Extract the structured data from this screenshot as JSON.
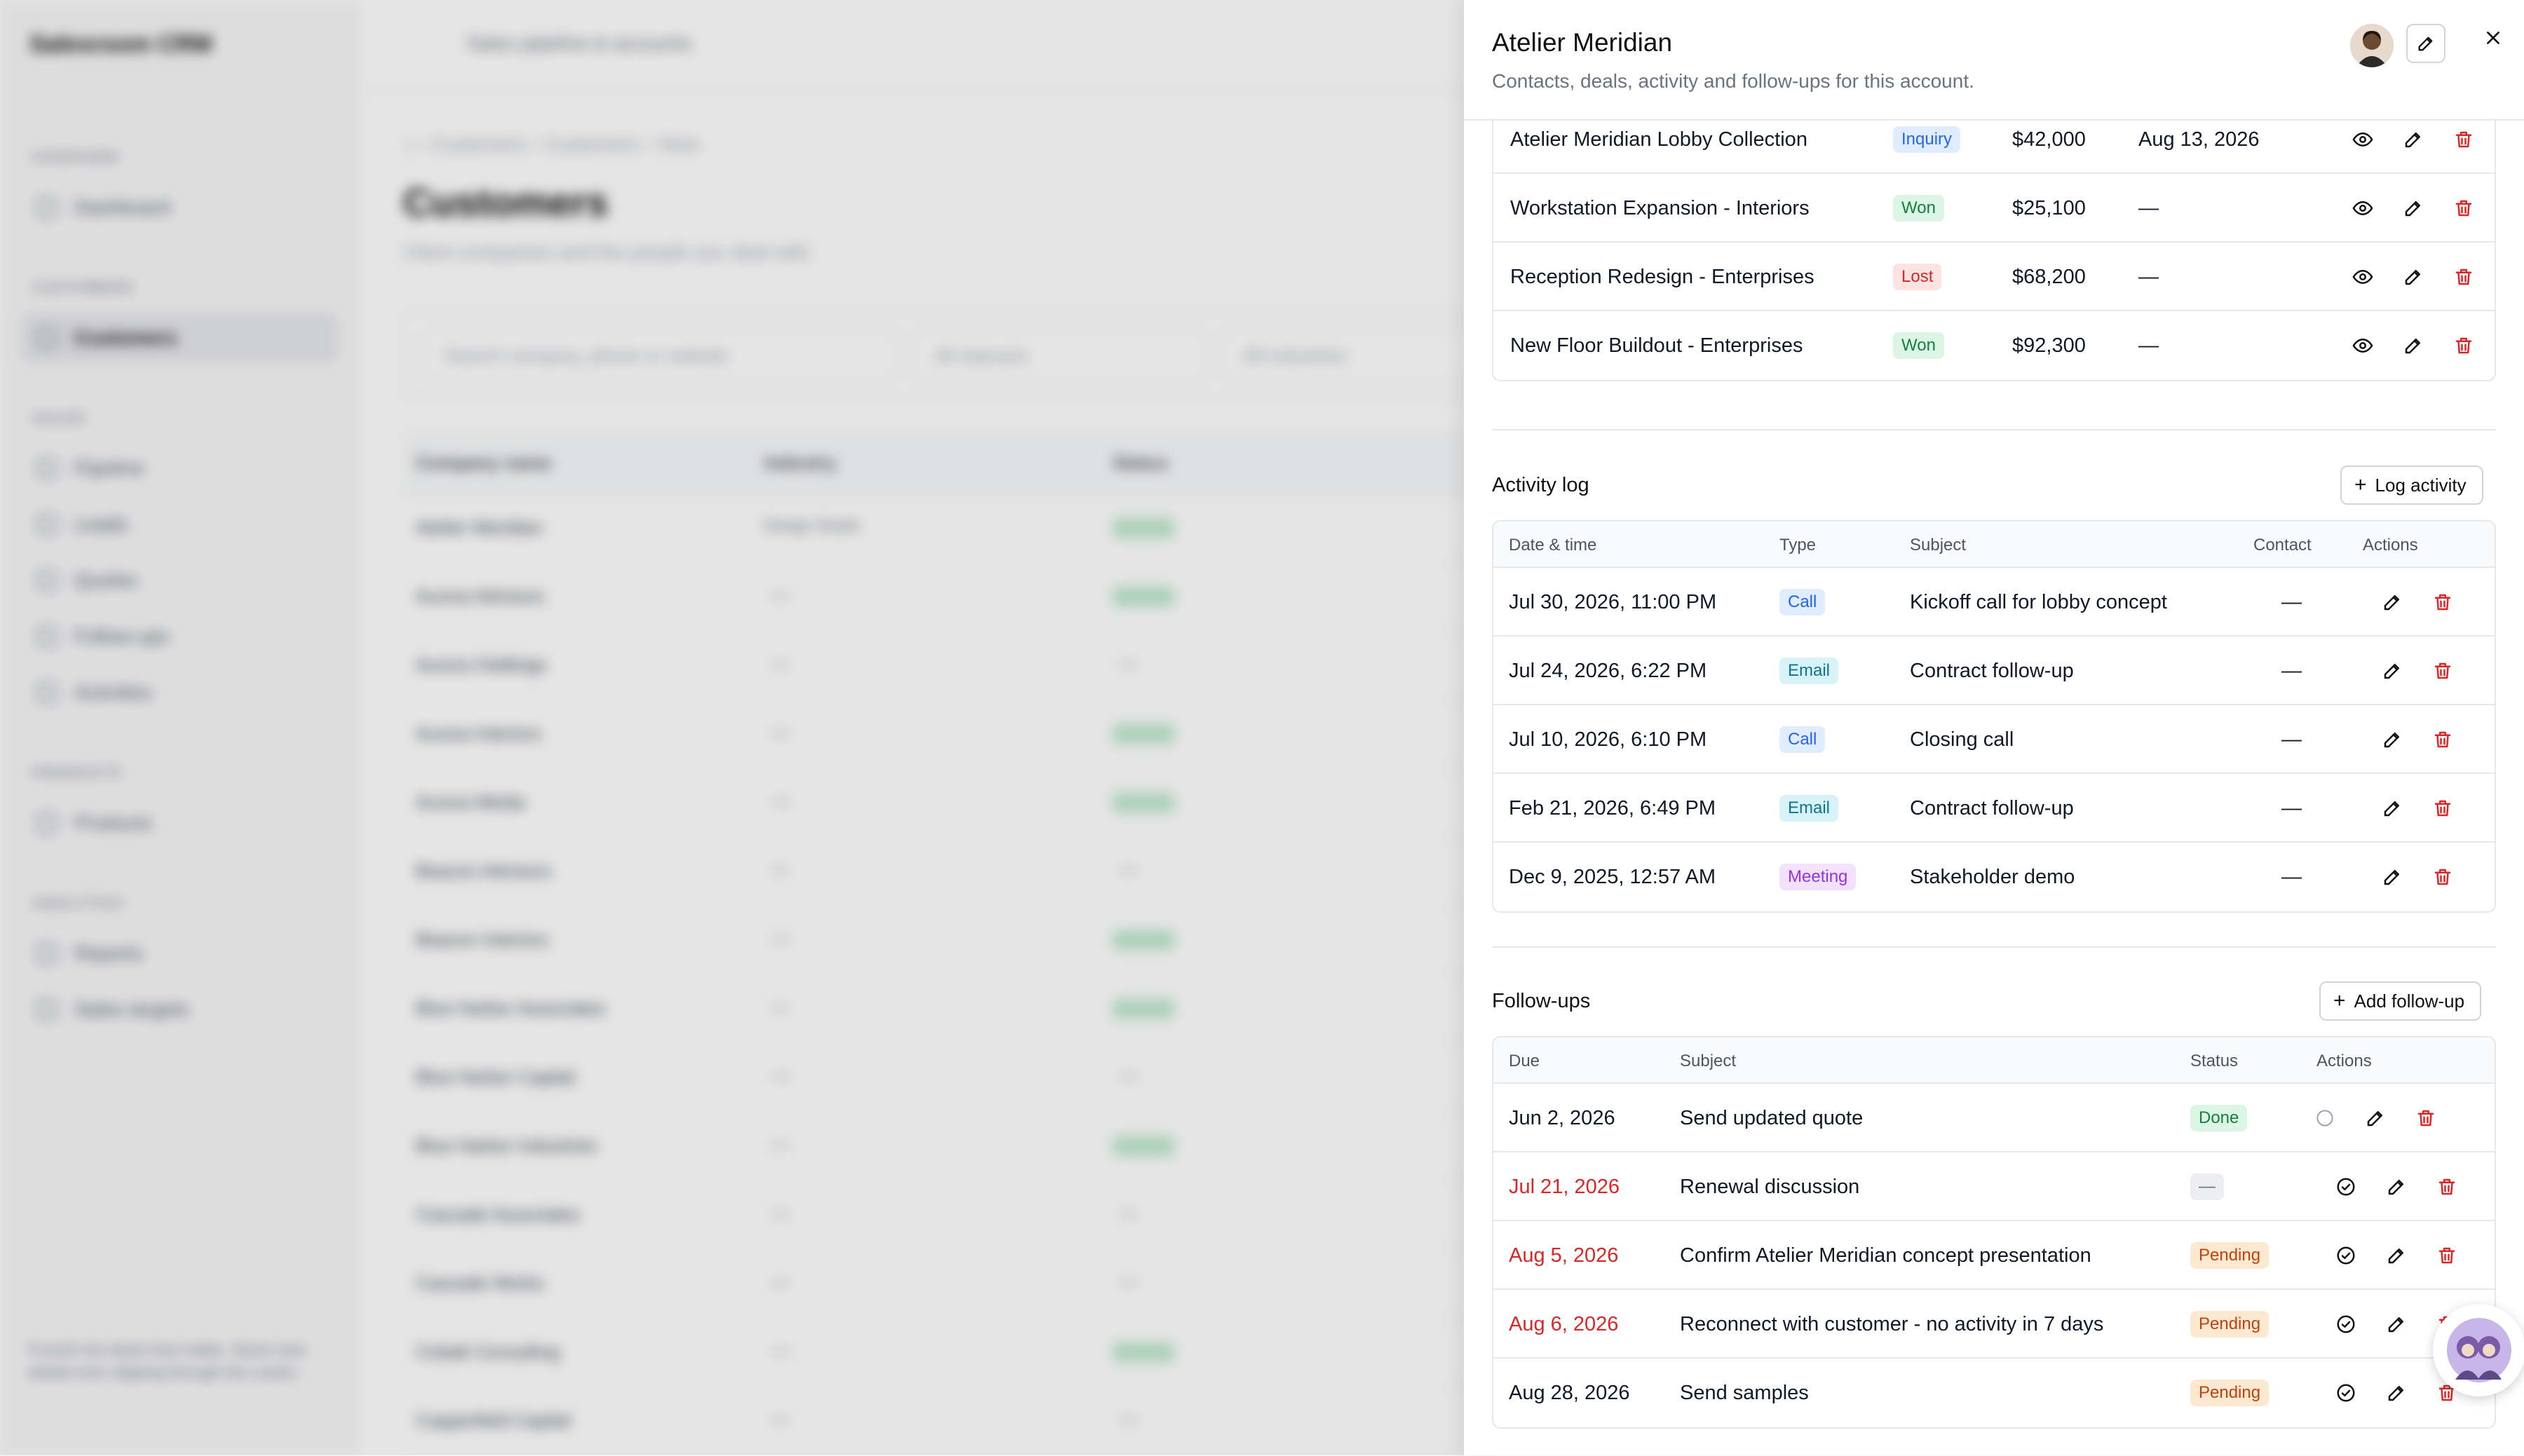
{
  "background": {
    "brand": "Salesroom CRM",
    "topbar_title": "Sales pipeline & accounts",
    "breadcrumb": [
      "Customers",
      "Customers",
      "View"
    ],
    "page_title": "Customers",
    "page_subtitle": "Client companies and the people you deal with.",
    "search_placeholder": "Search company, phone or website",
    "status_filter": "All statuses",
    "industry_filter": "All industries",
    "sidebar": {
      "sections": [
        {
          "label": "OVERVIEW",
          "items": [
            "Dashboard"
          ]
        },
        {
          "label": "CUSTOMERS",
          "items": [
            "Customers"
          ]
        },
        {
          "label": "SALES",
          "items": [
            "Pipeline",
            "Leads",
            "Quotes",
            "Follow-ups",
            "Activities"
          ]
        },
        {
          "label": "PRODUCTS",
          "items": [
            "Products"
          ]
        },
        {
          "label": "ANALYTICS",
          "items": [
            "Reports",
            "Sales targets"
          ]
        }
      ],
      "footer_note": "Furnish the deals that matter. Never lose details from slipping through the cracks."
    },
    "table_headers": [
      "Company name",
      "Industry",
      "Status"
    ],
    "rows": [
      {
        "name": "Atelier Meridian",
        "industry": "Design Studio",
        "active": true
      },
      {
        "name": "Aurora Advisors",
        "industry": "",
        "active": true
      },
      {
        "name": "Aurora Holdings",
        "industry": "",
        "active": false
      },
      {
        "name": "Aurora Interiors",
        "industry": "",
        "active": true
      },
      {
        "name": "Aurora Media",
        "industry": "",
        "active": true
      },
      {
        "name": "Beacon Advisors",
        "industry": "",
        "active": false
      },
      {
        "name": "Beacon Interiors",
        "industry": "",
        "active": true
      },
      {
        "name": "Blue Harbor Associates",
        "industry": "",
        "active": true
      },
      {
        "name": "Blue Harbor Capital",
        "industry": "",
        "active": false
      },
      {
        "name": "Blue Harbor Industries",
        "industry": "",
        "active": true
      },
      {
        "name": "Cascade Associates",
        "industry": "",
        "active": false
      },
      {
        "name": "Cascade Works",
        "industry": "",
        "active": false
      },
      {
        "name": "Cobalt Consulting",
        "industry": "",
        "active": true
      },
      {
        "name": "Copperfield Capital",
        "industry": "",
        "active": false
      }
    ]
  },
  "drawer": {
    "title": "Atelier Meridian",
    "subtitle": "Contacts, deals, activity and follow-ups for this account.",
    "deals": [
      {
        "name": "Atelier Meridian Lobby Collection",
        "stage": "Inquiry",
        "stage_color": "blue",
        "value": "$42,000",
        "close": "Aug 13, 2026"
      },
      {
        "name": "Workstation Expansion - Interiors",
        "stage": "Won",
        "stage_color": "green",
        "value": "$25,100",
        "close": "—"
      },
      {
        "name": "Reception Redesign - Enterprises",
        "stage": "Lost",
        "stage_color": "red",
        "value": "$68,200",
        "close": "—"
      },
      {
        "name": "New Floor Buildout - Enterprises",
        "stage": "Won",
        "stage_color": "green",
        "value": "$92,300",
        "close": "—"
      }
    ],
    "activity": {
      "title": "Activity log",
      "button": "Log activity",
      "headers": [
        "Date & time",
        "Type",
        "Subject",
        "Contact",
        "Actions"
      ],
      "rows": [
        {
          "date": "Jul 30, 2026, 11:00 PM",
          "type": "Call",
          "type_color": "blue",
          "subject": "Kickoff call for lobby concept",
          "contact": "—"
        },
        {
          "date": "Jul 24, 2026, 6:22 PM",
          "type": "Email",
          "type_color": "cyan",
          "subject": "Contract follow-up",
          "contact": "—"
        },
        {
          "date": "Jul 10, 2026, 6:10 PM",
          "type": "Call",
          "type_color": "blue",
          "subject": "Closing call",
          "contact": "—"
        },
        {
          "date": "Feb 21, 2026, 6:49 PM",
          "type": "Email",
          "type_color": "cyan",
          "subject": "Contract follow-up",
          "contact": "—"
        },
        {
          "date": "Dec 9, 2025, 12:57 AM",
          "type": "Meeting",
          "type_color": "purple",
          "subject": "Stakeholder demo",
          "contact": "—"
        }
      ]
    },
    "followups": {
      "title": "Follow-ups",
      "button": "Add follow-up",
      "headers": [
        "Due",
        "Subject",
        "Status",
        "Actions"
      ],
      "rows": [
        {
          "due": "Jun 2, 2026",
          "overdue": false,
          "subject": "Send updated quote",
          "status": "Done",
          "status_color": "green",
          "done": true
        },
        {
          "due": "Jul 21, 2026",
          "overdue": true,
          "subject": "Renewal discussion",
          "status": "—",
          "status_color": "gray",
          "done": false
        },
        {
          "due": "Aug 5, 2026",
          "overdue": true,
          "subject": "Confirm Atelier Meridian concept presentation",
          "status": "Pending",
          "status_color": "orange",
          "done": false
        },
        {
          "due": "Aug 6, 2026",
          "overdue": true,
          "subject": "Reconnect with customer - no activity in 7 days",
          "status": "Pending",
          "status_color": "orange",
          "done": false
        },
        {
          "due": "Aug 28, 2026",
          "overdue": false,
          "subject": "Send samples",
          "status": "Pending",
          "status_color": "orange",
          "done": false
        }
      ]
    }
  },
  "colors": {
    "accent_red": "#dc2626",
    "border": "#e5e7eb",
    "text": "#111827",
    "muted": "#6b7280"
  }
}
